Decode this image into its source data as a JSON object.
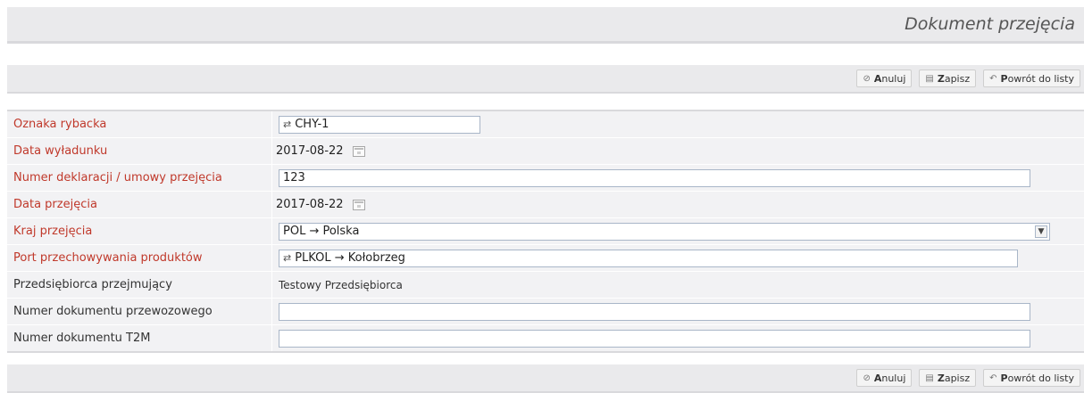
{
  "header": {
    "title": "Dokument przejęcia"
  },
  "toolbar": {
    "cancel_key": "A",
    "cancel_rest": "nuluj",
    "save_key": "Z",
    "save_rest": "apisz",
    "back_key": "P",
    "back_rest": "owrót do listy"
  },
  "form": {
    "fishing_mark": {
      "label": "Oznaka rybacka",
      "value": "CHY-1"
    },
    "landing_date": {
      "label": "Data wyładunku",
      "value": "2017-08-22"
    },
    "declaration_number": {
      "label": "Numer deklaracji / umowy przejęcia",
      "value": "123"
    },
    "takeover_date": {
      "label": "Data przejęcia",
      "value": "2017-08-22"
    },
    "takeover_country": {
      "label": "Kraj przejęcia",
      "value": "POL → Polska"
    },
    "storage_port": {
      "label": "Port przechowywania produktów",
      "value": "PLKOL → Kołobrzeg"
    },
    "receiving_company": {
      "label": "Przedsiębiorca przejmujący",
      "value": "Testowy Przedsiębiorca"
    },
    "transport_doc": {
      "label": "Numer dokumentu przewozowego",
      "value": ""
    },
    "t2m_doc": {
      "label": "Numer dokumentu T2M",
      "value": ""
    }
  },
  "icons": {
    "cancel": "cancel-icon",
    "save": "save-icon",
    "back": "back-arrow-icon",
    "calendar": "calendar-icon",
    "swap": "swap-arrows-icon",
    "dropdown": "chevron-down-icon"
  }
}
